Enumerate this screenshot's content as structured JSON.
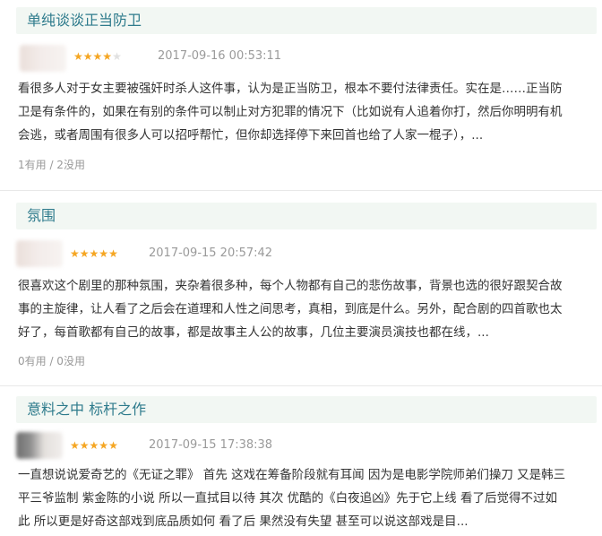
{
  "reviews": [
    {
      "title": "单纯谈谈正当防卫",
      "rating": 4,
      "max_rating": 5,
      "time": "2017-09-16 00:53:11",
      "lines": [
        "看很多人对于女主要被强奸时杀人这件事，认为是正当防卫，根本不要付法律责任。实在是……正当防",
        "卫是有条件的，如果在有别的条件可以制止对方犯罪的情况下（比如说有人追着你打，然后你明明有机",
        "会逃，或者周围有很多人可以招呼帮忙，但你却选择停下来回首也给了人家一棍子），..."
      ],
      "votes": "1有用 / 2没用"
    },
    {
      "title": "氛围",
      "rating": 5,
      "max_rating": 5,
      "time": "2017-09-15 20:57:42",
      "lines": [
        "很喜欢这个剧里的那种氛围，夹杂着很多种，每个人物都有自己的悲伤故事，背景也选的很好跟契合故",
        "事的主旋律，让人看了之后会在道理和人性之间思考，真相，到底是什么。另外，配合剧的四首歌也太",
        "好了，每首歌都有自己的故事，都是故事主人公的故事，几位主要演员演技也都在线，..."
      ],
      "votes": "0有用 / 0没用"
    },
    {
      "title": "意料之中 标杆之作",
      "rating": 5,
      "max_rating": 5,
      "time": "2017-09-15 17:38:38",
      "lines": [
        "一直想说说爱奇艺的《无证之罪》 首先 这戏在筹备阶段就有耳闻 因为是电影学院师弟们操刀 又是韩三",
        "平三爷监制 紫金陈的小说 所以一直拭目以待 其次 优酷的《白夜追凶》先于它上线 看了后觉得不过如",
        "此 所以更是好奇这部戏到底品质如何 看了后 果然没有失望 甚至可以说这部戏是目..."
      ],
      "votes": ""
    }
  ]
}
